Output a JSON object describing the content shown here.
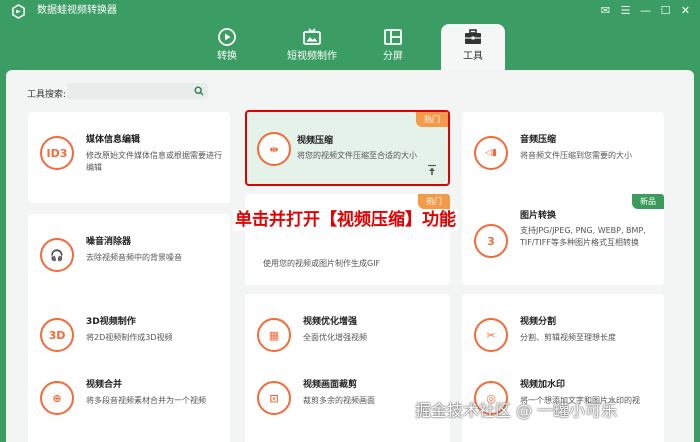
{
  "app": {
    "title": "数据蛙视频转换器"
  },
  "window_controls": {
    "feedback": "✉",
    "menu": "☰",
    "minimize": "—",
    "maximize": "☐",
    "close": "✕"
  },
  "tabs": [
    {
      "label": "转换",
      "icon": "convert-icon"
    },
    {
      "label": "短视频制作",
      "icon": "tv-icon"
    },
    {
      "label": "分屏",
      "icon": "split-screen-icon"
    },
    {
      "label": "工具",
      "icon": "toolbox-icon",
      "active": true
    }
  ],
  "search": {
    "label": "工具搜索:",
    "placeholder": ""
  },
  "tools": [
    {
      "title": "媒体信息编辑",
      "desc": "修改原始文件媒体信息或根据需要进行编辑",
      "icon_text": "ID3",
      "badge": ""
    },
    {
      "title": "视频压缩",
      "desc": "将您的视频文件压缩至合适的大小",
      "icon_text": "⇹",
      "badge": "热门"
    },
    {
      "title": "音频压缩",
      "desc": "将音频文件压缩到您需要的大小",
      "icon_text": "◁▮",
      "badge": ""
    },
    {
      "title": "噪音消除器",
      "desc": "去除视频音频中的背景噪音",
      "icon_text": "🎧",
      "badge": ""
    },
    {
      "title": "",
      "desc": "使用您的视频或图片制作生成GIF",
      "icon_text": "",
      "badge": "热门"
    },
    {
      "title": "图片转换",
      "desc": "支持JPG/JPEG, PNG, WEBP, BMP, TIF/TIFF等多种图片格式互相转换",
      "icon_text": "3",
      "badge": "新品"
    },
    {
      "title": "3D视频制作",
      "desc": "将2D视频制作成3D视频",
      "icon_text": "3D",
      "badge": ""
    },
    {
      "title": "视频优化增强",
      "desc": "全面优化增强视频",
      "icon_text": "▦",
      "badge": ""
    },
    {
      "title": "视频分割",
      "desc": "分割、剪辑视频至理想长度",
      "icon_text": "✂",
      "badge": ""
    },
    {
      "title": "视频合并",
      "desc": "将多段音视频素材合并为一个视频",
      "icon_text": "⊕",
      "badge": ""
    },
    {
      "title": "视频画面裁剪",
      "desc": "裁剪多余的视频画面",
      "icon_text": "⊡",
      "badge": ""
    },
    {
      "title": "视频加水印",
      "desc": "将一个想添加文字和图片水印的视",
      "icon_text": "◎",
      "badge": ""
    }
  ],
  "overlay_caption": "单击并打开【视频压缩】功能",
  "watermark": "掘金技术社区 @ 一罐小可乐",
  "colors": {
    "brand_green": "#3b9d63",
    "accent_orange": "#f46a38",
    "highlight_red": "#e00000",
    "hot_badge": "#f49a4b",
    "new_badge": "#3a9b5d"
  }
}
